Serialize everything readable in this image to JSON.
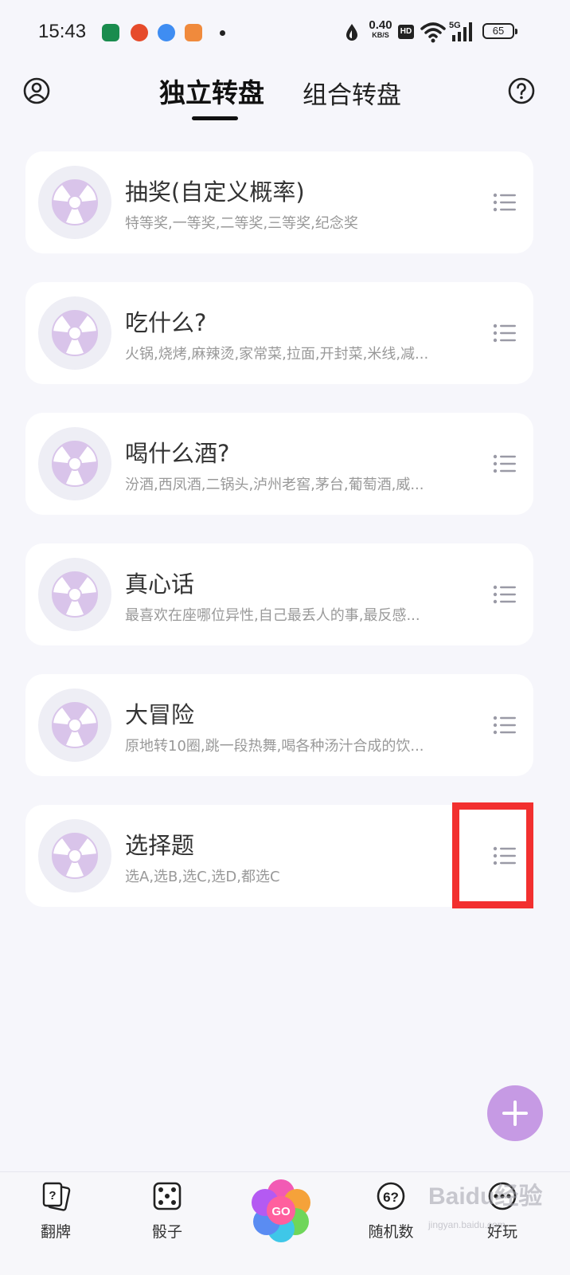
{
  "status_bar": {
    "time": "15:43",
    "net_speed_value": "0.40",
    "net_speed_unit": "KB/S",
    "hd_badge": "HD",
    "signal_label": "5G",
    "battery_level": "65"
  },
  "header": {
    "tab_active": "独立转盘",
    "tab_inactive": "组合转盘",
    "left_icon": "profile-icon",
    "right_icon": "help-icon"
  },
  "wheels": [
    {
      "title": "抽奖(自定义概率)",
      "subtitle": "特等奖,一等奖,二等奖,三等奖,纪念奖"
    },
    {
      "title": "吃什么?",
      "subtitle": "火锅,烧烤,麻辣烫,家常菜,拉面,开封菜,米线,减..."
    },
    {
      "title": "喝什么酒?",
      "subtitle": "汾酒,西凤酒,二锅头,泸州老窖,茅台,葡萄酒,威..."
    },
    {
      "title": "真心话",
      "subtitle": "最喜欢在座哪位异性,自己最丢人的事,最反感..."
    },
    {
      "title": "大冒险",
      "subtitle": "原地转10圈,跳一段热舞,喝各种汤汁合成的饮..."
    },
    {
      "title": "选择题",
      "subtitle": "选A,选B,选C,选D,都选C"
    }
  ],
  "bottom_nav": {
    "cards": "翻牌",
    "dice": "骰子",
    "go": "GO",
    "random": "随机数",
    "random_icon_text": "6?",
    "fun": "好玩"
  },
  "watermark": {
    "brand": "Baidu经验",
    "url": "jingyan.baidu.com"
  },
  "colors": {
    "accent": "#c69ae4",
    "highlight": "#f2302f",
    "wheel_icon": "#d9c4ea"
  }
}
